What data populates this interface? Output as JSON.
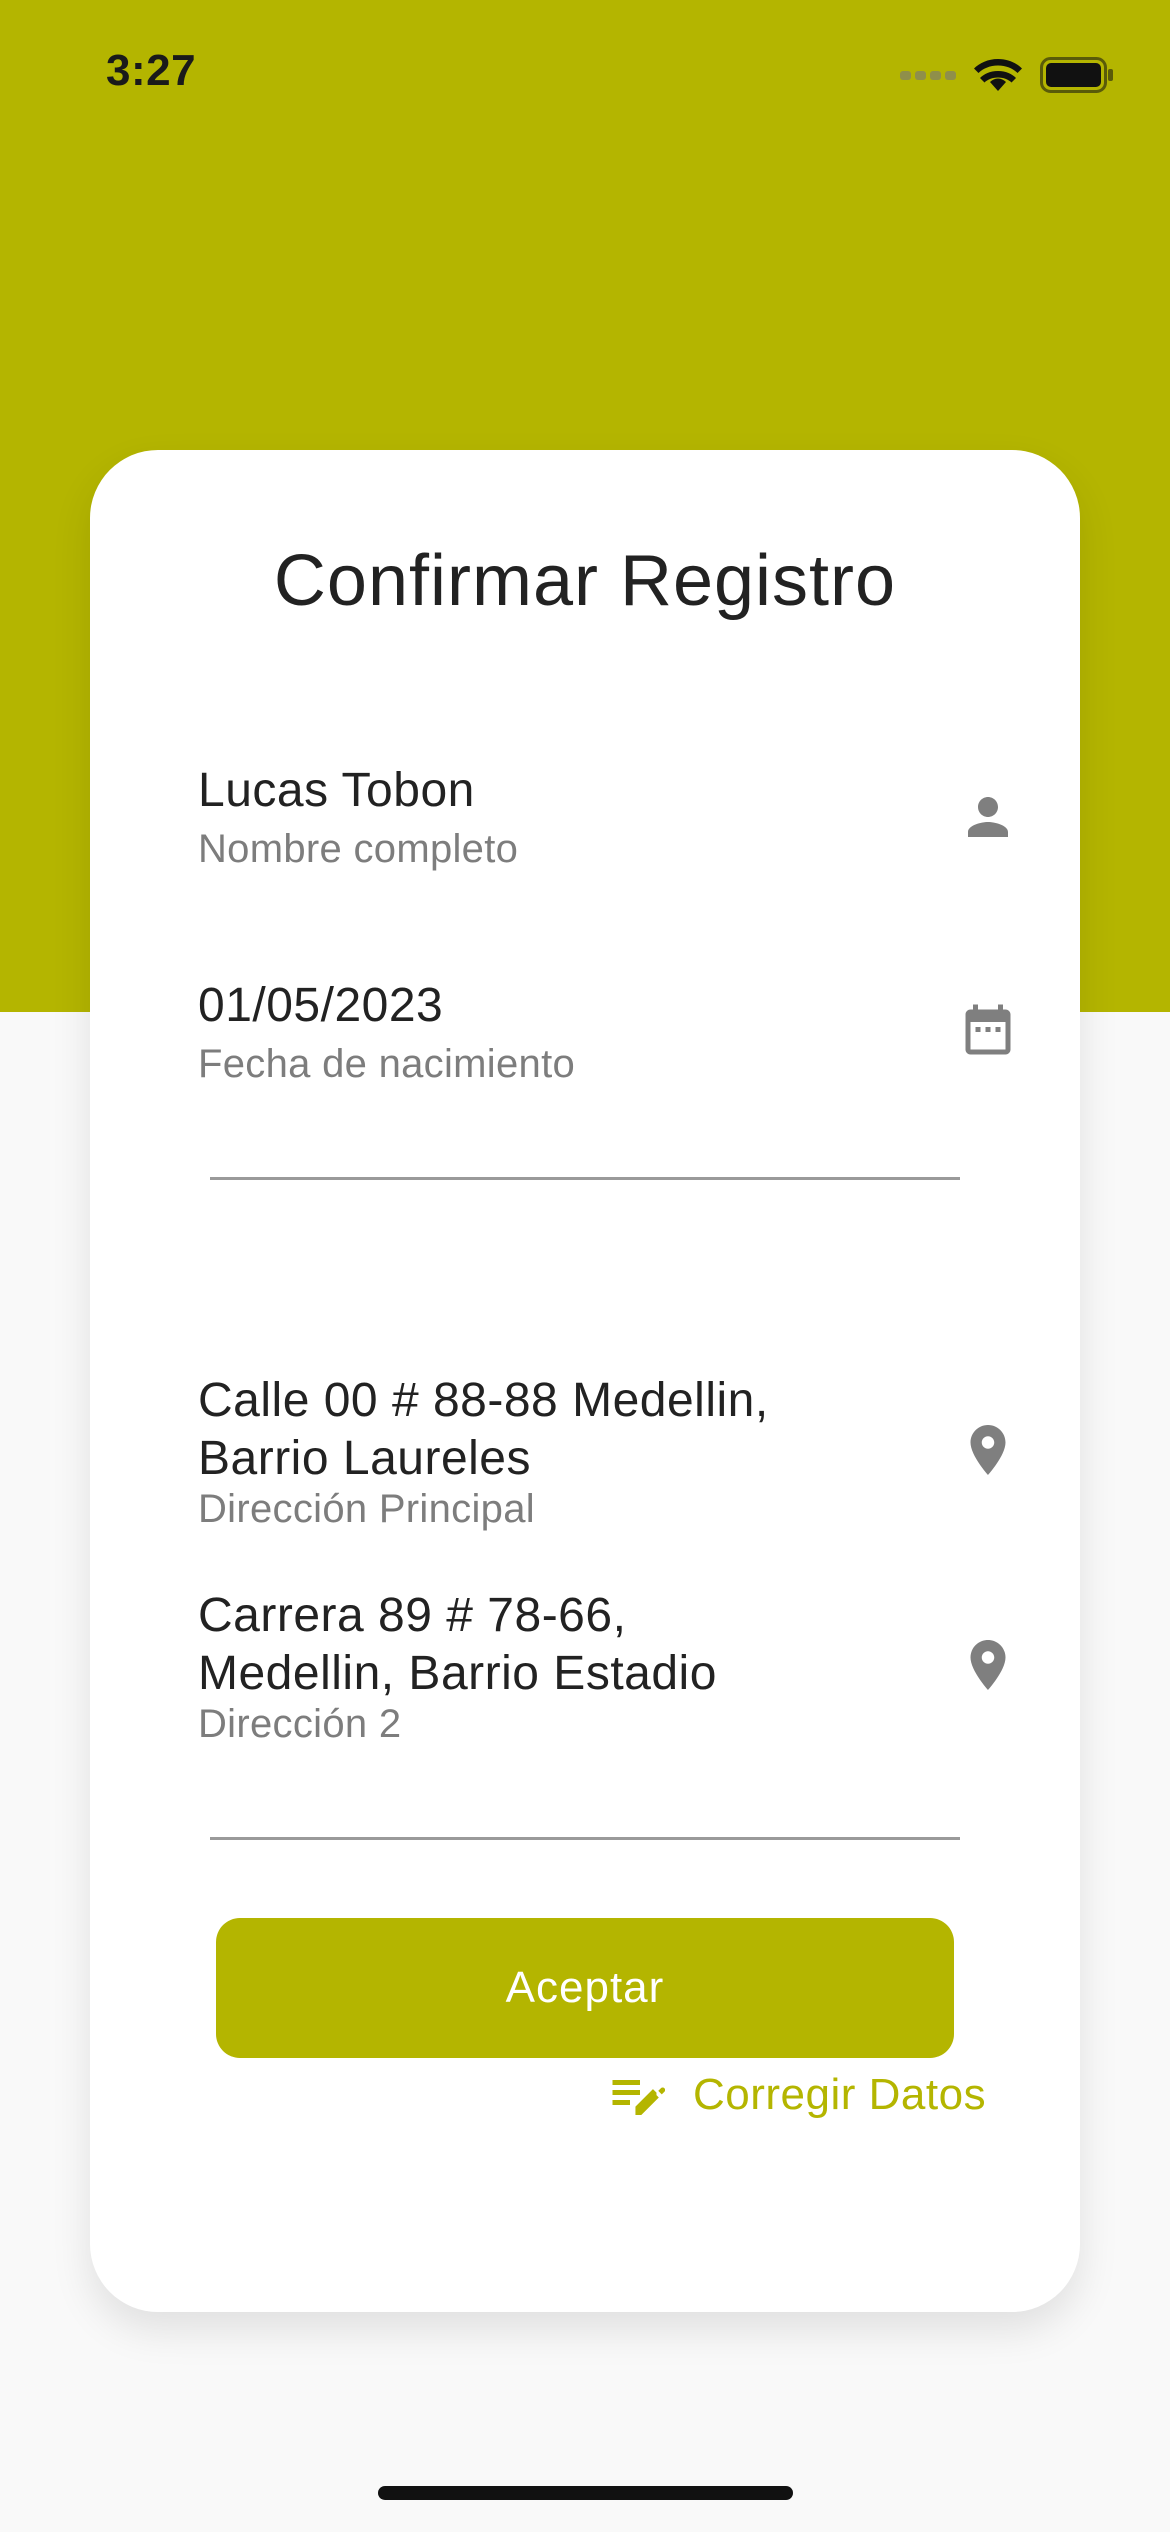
{
  "status_bar": {
    "time": "3:27"
  },
  "card": {
    "title": "Confirmar Registro",
    "fields": [
      {
        "value": "Lucas Tobon",
        "label": "Nombre completo",
        "icon": "person-icon"
      },
      {
        "value": "01/05/2023",
        "label": "Fecha de nacimiento",
        "icon": "calendar-icon"
      },
      {
        "value_lines": [
          "Calle 00 # 88-88 Medellin,",
          "Barrio Laureles"
        ],
        "label": "Dirección Principal",
        "icon": "location-pin-icon"
      },
      {
        "value_lines": [
          "Carrera 89 # 78-66,",
          "Medellin, Barrio Estadio"
        ],
        "label": "Dirección 2",
        "icon": "location-pin-icon"
      }
    ],
    "accept_label": "Aceptar",
    "correct_label": "Corregir Datos"
  },
  "colors": {
    "brand": "#b4b500",
    "background": "#f9f9f9",
    "card": "#ffffff",
    "icon_gray": "#7f7f7f"
  }
}
